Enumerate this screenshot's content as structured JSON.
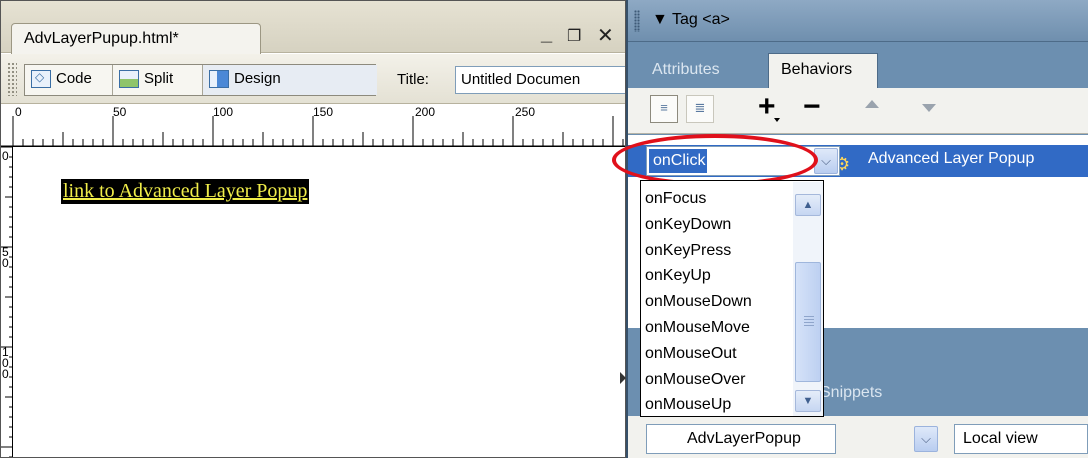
{
  "document": {
    "tab_title": "AdvLayerPupup.html*",
    "window_controls": [
      "_",
      "ɑ",
      "✕"
    ],
    "views": [
      {
        "label": "Code",
        "icon": "code-view-icon"
      },
      {
        "label": "Split",
        "icon": "split-view-icon"
      },
      {
        "label": "Design",
        "icon": "design-view-icon"
      }
    ],
    "title_label": "Title:",
    "title_value": "Untitled Documen",
    "ruler_h": [
      "0",
      "50",
      "100",
      "150",
      "200",
      "250"
    ],
    "ruler_v": [
      "0",
      "5\n0",
      "1\n0\n0"
    ],
    "link_text": "link to Advanced Layer Popup"
  },
  "panel": {
    "header_title": "▼ Tag <a>",
    "tabs": {
      "attributes": "Attributes",
      "behaviors": "Behaviors"
    },
    "toolbar": {
      "add": "+",
      "remove": "−"
    },
    "behavior": {
      "event": "onClick",
      "action": "Advanced Layer Popup"
    },
    "event_options": [
      "onFocus",
      "onKeyDown",
      "onKeyPress",
      "onKeyUp",
      "onMouseDown",
      "onMouseMove",
      "onMouseOut",
      "onMouseOver",
      "onMouseUp"
    ],
    "files": {
      "snippets_tab": "Snippets",
      "site": "AdvLayerPopup",
      "view": "Local view"
    }
  },
  "colors": {
    "selection": "#316ac5",
    "highlight_ellipse": "#e0101b",
    "panel_bg": "#6c8fb0",
    "link_fg": "#f1ee4a"
  }
}
